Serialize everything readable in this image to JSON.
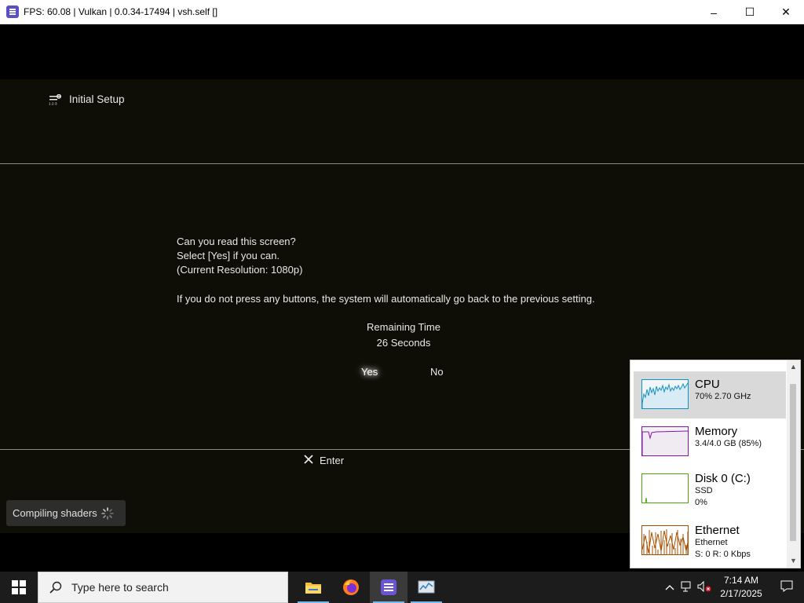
{
  "window": {
    "title": "FPS: 60.08 | Vulkan | 0.0.34-17494 | vsh.self []",
    "minimize": "–",
    "maximize": "☐",
    "close": "✕"
  },
  "game": {
    "header": "Initial Setup",
    "lines": [
      "Can you read this screen?",
      "Select [Yes] if you can.",
      "(Current Resolution: 1080p)"
    ],
    "warning": "If you do not press any buttons, the system will automatically go back to the previous setting.",
    "remaining_label": "Remaining Time",
    "remaining_value": "26 Seconds",
    "yes": "Yes",
    "no": "No",
    "enter": "Enter",
    "toast": "Compiling shaders"
  },
  "perf": {
    "items": [
      {
        "name": "CPU",
        "sub1": "70% 2.70 GHz",
        "sub2": "",
        "sub3": "",
        "color": "#1191c1"
      },
      {
        "name": "Memory",
        "sub1": "3.4/4.0 GB (85%)",
        "sub2": "",
        "sub3": "",
        "color": "#8b12ae"
      },
      {
        "name": "Disk 0 (C:)",
        "sub1": "SSD",
        "sub2": "0%",
        "sub3": "",
        "color": "#4da60c"
      },
      {
        "name": "Ethernet",
        "sub1": "Ethernet",
        "sub2": "S: 0 R: 0 Kbps",
        "sub3": "",
        "color": "#a74f01"
      }
    ]
  },
  "taskbar": {
    "search_placeholder": "Type here to search",
    "time": "7:14 AM",
    "date": "2/17/2025"
  }
}
